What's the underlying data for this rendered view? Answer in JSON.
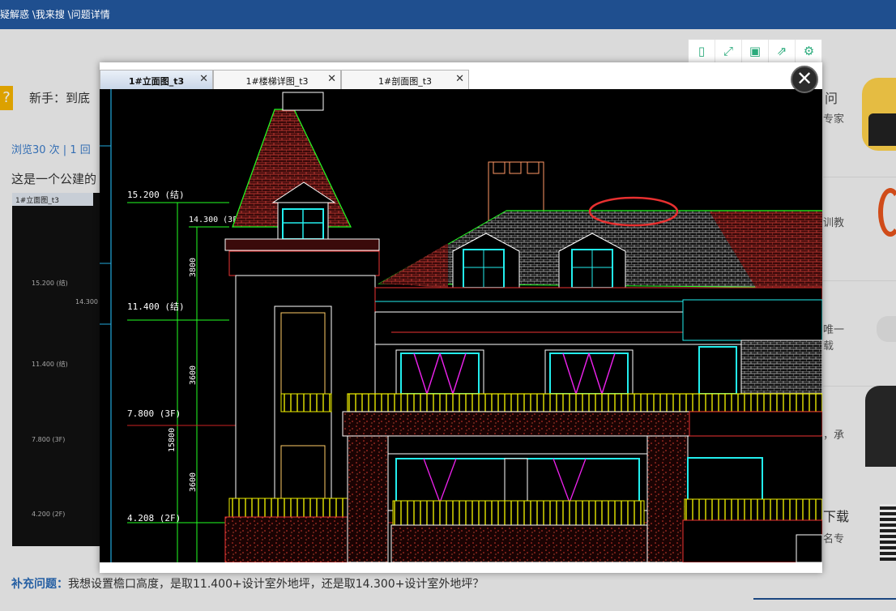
{
  "breadcrumb": "疑解惑 \\我来搜 \\问题详情",
  "question": {
    "title_partial": "新手：到底",
    "stats": "浏览30 次 | 1 回",
    "description_partial": "这是一个公建的",
    "supplement_label": "补充问题：",
    "supplement_text": "我想设置檐口高度，是取11.400+设计室外地坪，还是取14.300+设计室外地坪？"
  },
  "thumbnail": {
    "tab": "1#立面图_t3",
    "levels": [
      "15.200 (结)",
      "14.300",
      "11.400 (结)",
      "7.800 (3F)",
      "4.200 (2F)"
    ]
  },
  "sidebar": {
    "ask_partial": "问",
    "expert_partial": "专家",
    "teach_partial": "训教",
    "only_partial": "唯一",
    "crowd_partial": "载",
    "promise_partial": "，承",
    "download_partial": "下载",
    "pro_partial": "名专"
  },
  "viewer": {
    "tabs": [
      {
        "label": "1#立面图_t3",
        "active": true
      },
      {
        "label": "1#楼梯详图_t3",
        "active": false
      },
      {
        "label": "1#剖面图_t3",
        "active": false
      }
    ],
    "tab_close": "✕",
    "close_glyph": "✕",
    "toolbar": [
      {
        "icon": "phone-icon",
        "glyph": "▯"
      },
      {
        "icon": "expand-icon",
        "glyph": "⤢"
      },
      {
        "icon": "save-icon",
        "glyph": "▣"
      },
      {
        "icon": "share-icon",
        "glyph": "⇗"
      },
      {
        "icon": "gear-icon",
        "glyph": "⚙"
      }
    ],
    "drawing_labels": {
      "lvl1": "15.200 (结)",
      "lvl2": "14.300 (3F)",
      "lvl3": "11.400 (结)",
      "lvl4": "7.800 (3F)",
      "lvl5": "4.208 (2F)",
      "dim1": "3800",
      "dim2": "3600",
      "dim3": "3600",
      "dim_total": "15800"
    }
  },
  "colors": {
    "nav": "#1f4f8f",
    "accent_green": "#2bab7c",
    "drawing_bg": "#000000"
  }
}
